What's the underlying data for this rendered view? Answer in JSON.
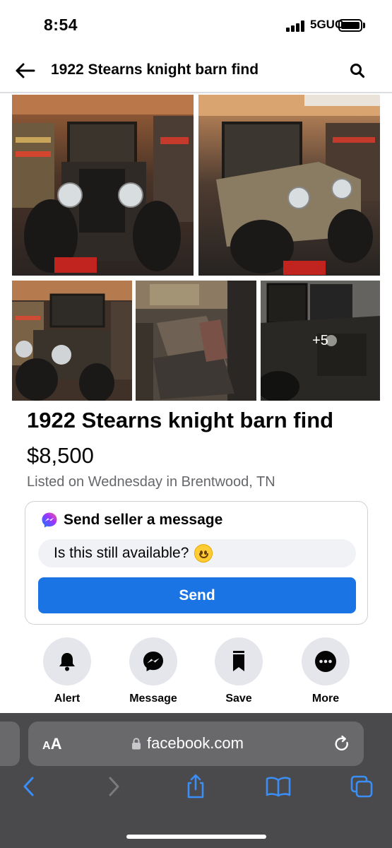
{
  "status_bar": {
    "time": "8:54",
    "network": "5GUC"
  },
  "header": {
    "title": "1922 Stearns knight barn find"
  },
  "photos": {
    "more_count": "+5"
  },
  "listing": {
    "title": "1922 Stearns knight barn find",
    "price": "$8,500",
    "listed": "Listed on Wednesday in Brentwood, TN"
  },
  "message_card": {
    "heading": "Send seller a message",
    "input_value": "Is this still available?",
    "send_label": "Send"
  },
  "actions": [
    {
      "label": "Alert",
      "icon": "bell-icon"
    },
    {
      "label": "Message",
      "icon": "messenger-icon"
    },
    {
      "label": "Save",
      "icon": "bookmark-icon"
    },
    {
      "label": "More",
      "icon": "more-icon"
    }
  ],
  "browser": {
    "text_size_label_small": "A",
    "text_size_label_big": "A",
    "url": "facebook.com"
  },
  "colors": {
    "accent": "#1b74e4",
    "safari_bar": "#4a4a4c",
    "link_blue": "#3a8ef6"
  }
}
